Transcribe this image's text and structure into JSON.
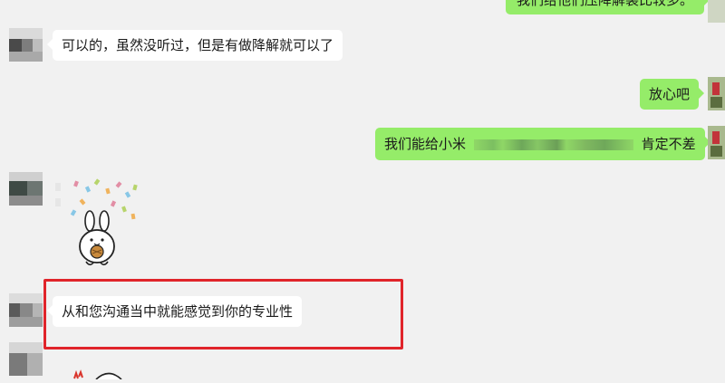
{
  "chat": {
    "messages": [
      {
        "side": "right",
        "text": "我们给他们压降解装比较多。",
        "partial": true
      },
      {
        "side": "left",
        "text": "可以的，虽然没听过，但是有做降解就可以了"
      },
      {
        "side": "right",
        "text": "放心吧"
      },
      {
        "side": "right",
        "text_start": "我们能给小米",
        "text_end": "肯定不差",
        "redacted": true
      },
      {
        "side": "left",
        "type": "sticker",
        "sticker_name": "bunny-confetti-sticker"
      },
      {
        "side": "left",
        "text": "从和您沟通当中就能感觉到你的专业性",
        "highlighted": true
      }
    ]
  },
  "colors": {
    "background": "#f1f1f1",
    "left_bubble": "#ffffff",
    "right_bubble": "#95ec69",
    "highlight_border": "#e0242a"
  }
}
